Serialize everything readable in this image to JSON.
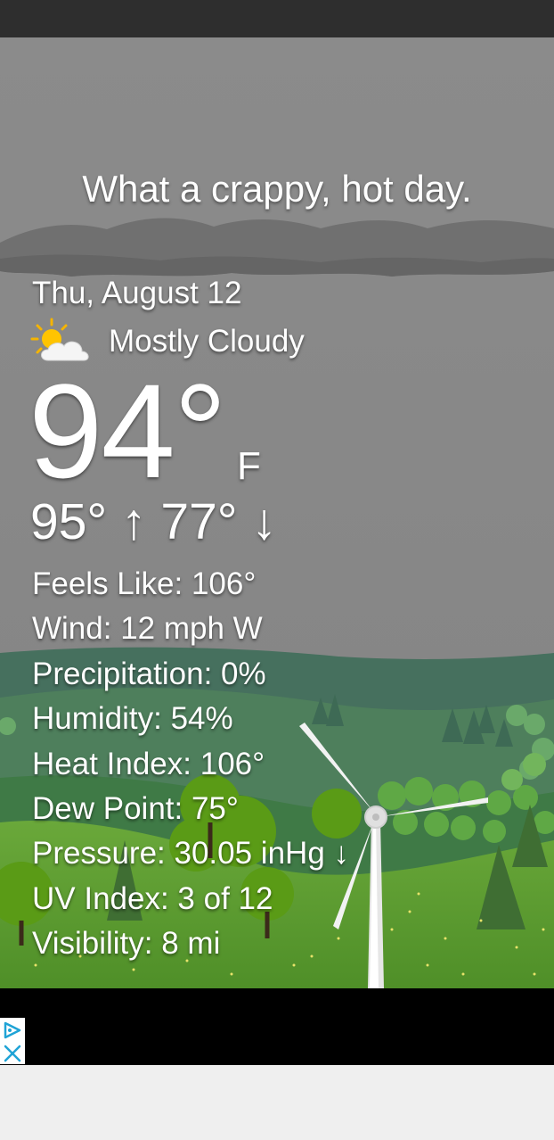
{
  "weather": {
    "tagline": "What a crappy, hot day.",
    "date": "Thu, August 12",
    "condition": "Mostly Cloudy",
    "condition_icon": "partly-cloudy-icon",
    "temperature": "94°",
    "unit": "F",
    "hi_lo": "95° ↑ 77° ↓",
    "details": [
      "Feels Like:  106°",
      "Wind:  12 mph W",
      "Precipitation:   0%",
      "Humidity:  54%",
      "Heat Index:  106°",
      "Dew Point:  75°",
      "Pressure:  30.05 inHg ↓",
      "UV Index:  3 of 12",
      "Visibility:  8 mi"
    ]
  },
  "ad": {
    "icon": "adchoices-icon",
    "close_icon": "close-icon"
  },
  "colors": {
    "sky": "#8a8a8a",
    "status_bar": "#2e2e2e",
    "ad_bar": "#000000",
    "grass": "#5f9e31"
  }
}
